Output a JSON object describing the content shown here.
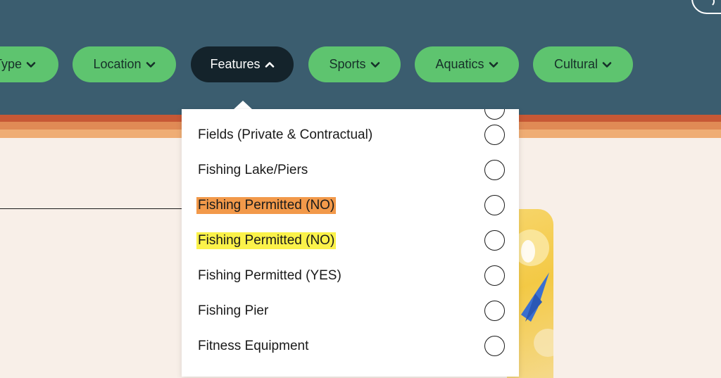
{
  "colors": {
    "header_bg": "#3b5d6f",
    "pill_green": "#5ec46f",
    "pill_active": "#14232b",
    "stripe_1": "#c75835",
    "stripe_2": "#e08a55",
    "stripe_3": "#efad74",
    "page_bg": "#f8efe8",
    "highlight_orange": "#f2994a",
    "highlight_yellow": "#fbf24a"
  },
  "filters": [
    {
      "label": "Type",
      "icon": "chevron-down-icon",
      "active": false
    },
    {
      "label": "Location",
      "icon": "chevron-down-icon",
      "active": false
    },
    {
      "label": "Features",
      "icon": "chevron-up-icon",
      "active": true
    },
    {
      "label": "Sports",
      "icon": "chevron-down-icon",
      "active": false
    },
    {
      "label": "Aquatics",
      "icon": "chevron-down-icon",
      "active": false
    },
    {
      "label": "Cultural",
      "icon": "chevron-down-icon",
      "active": false
    }
  ],
  "features_dropdown": {
    "options": [
      {
        "label": "Fields (Private & Contractual)",
        "checked": false,
        "highlight": null
      },
      {
        "label": "Fishing Lake/Piers",
        "checked": false,
        "highlight": null
      },
      {
        "label": "Fishing Permitted (NO)",
        "checked": false,
        "highlight": "orange"
      },
      {
        "label": "Fishing Permitted (NO)",
        "checked": false,
        "highlight": "yellow"
      },
      {
        "label": "Fishing Permitted (YES)",
        "checked": false,
        "highlight": null
      },
      {
        "label": "Fishing Pier",
        "checked": false,
        "highlight": null
      },
      {
        "label": "Fitness Equipment",
        "checked": false,
        "highlight": null
      }
    ]
  }
}
